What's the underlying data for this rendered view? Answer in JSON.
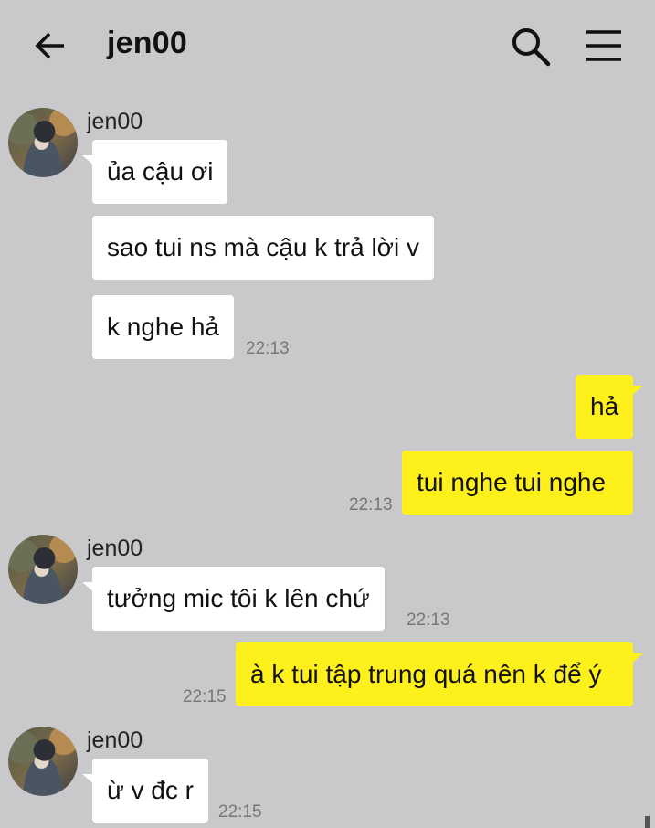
{
  "header": {
    "title": "jen00",
    "back_icon": "arrow-left-icon",
    "search_icon": "search-icon",
    "menu_icon": "hamburger-menu-icon"
  },
  "colors": {
    "background": "#c9c9cb",
    "incoming_bubble": "#ffffff",
    "outgoing_bubble": "#fef01b",
    "timestamp": "#777777"
  },
  "messages": [
    {
      "from": "jen00",
      "direction": "in",
      "sender": "jen00",
      "text": "ủa cậu ơi"
    },
    {
      "from": "jen00",
      "direction": "in",
      "text": "sao tui ns mà cậu k trả lời v"
    },
    {
      "from": "jen00",
      "direction": "in",
      "text": "k nghe hả",
      "time": "22:13"
    },
    {
      "from": "me",
      "direction": "out",
      "text": "hả"
    },
    {
      "from": "me",
      "direction": "out",
      "text": "tui nghe tui nghe",
      "time": "22:13"
    },
    {
      "from": "jen00",
      "direction": "in",
      "sender": "jen00",
      "text": "tưởng mic tôi k lên chứ",
      "time": "22:13"
    },
    {
      "from": "me",
      "direction": "out",
      "text": "à k tui tập trung quá nên k để ý",
      "time": "22:15"
    },
    {
      "from": "jen00",
      "direction": "in",
      "sender": "jen00",
      "text": "ừ v đc r",
      "time": "22:15"
    }
  ]
}
